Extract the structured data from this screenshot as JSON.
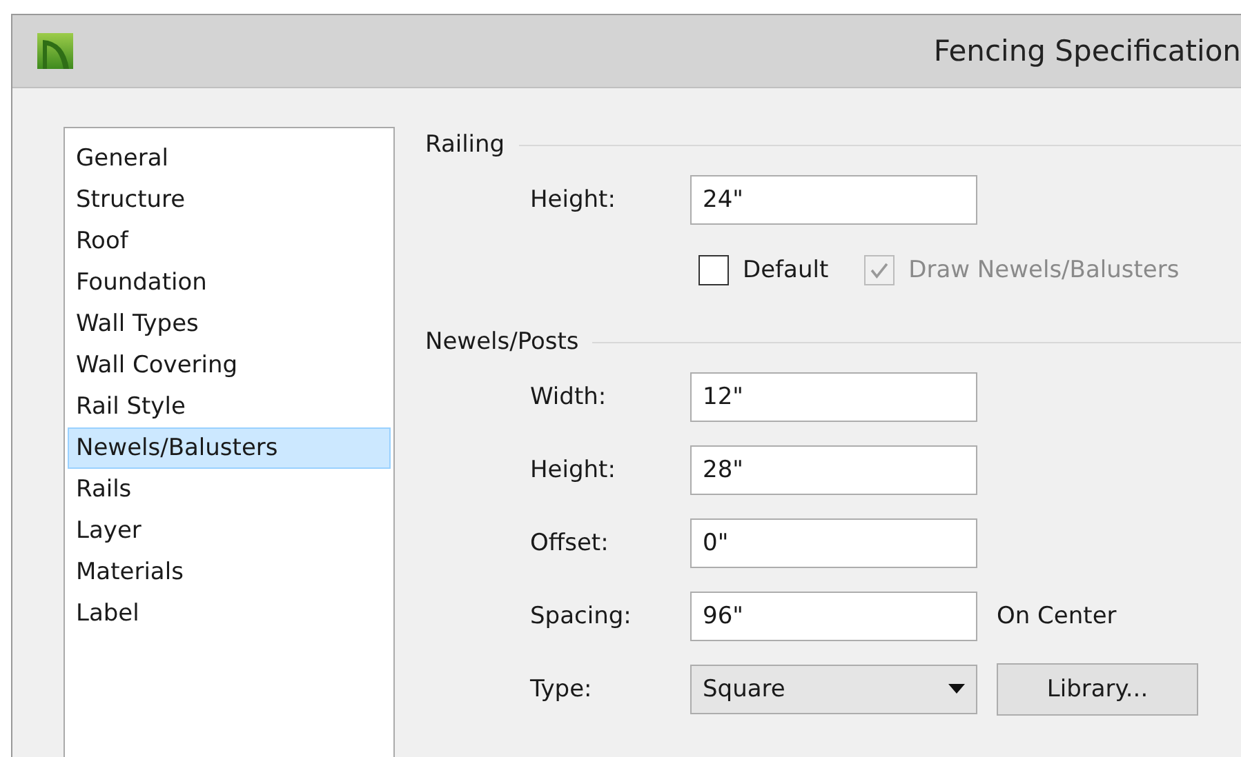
{
  "window": {
    "title": "Fencing Specification"
  },
  "sidebar": {
    "items": [
      {
        "label": "General",
        "selected": false
      },
      {
        "label": "Structure",
        "selected": false
      },
      {
        "label": "Roof",
        "selected": false
      },
      {
        "label": "Foundation",
        "selected": false
      },
      {
        "label": "Wall Types",
        "selected": false
      },
      {
        "label": "Wall Covering",
        "selected": false
      },
      {
        "label": "Rail Style",
        "selected": false
      },
      {
        "label": "Newels/Balusters",
        "selected": true
      },
      {
        "label": "Rails",
        "selected": false
      },
      {
        "label": "Layer",
        "selected": false
      },
      {
        "label": "Materials",
        "selected": false
      },
      {
        "label": "Label",
        "selected": false
      }
    ]
  },
  "railing": {
    "title": "Railing",
    "fields": [
      {
        "label": "Height:",
        "value": "24\""
      }
    ],
    "checkboxes": [
      {
        "label": "Default",
        "checked": false,
        "disabled": false
      },
      {
        "label": "Draw Newels/Balusters",
        "checked": true,
        "disabled": true
      }
    ]
  },
  "newels_posts": {
    "title": "Newels/Posts",
    "fields": [
      {
        "label": "Width:",
        "value": "12\"",
        "kind": "text"
      },
      {
        "label": "Height:",
        "value": "28\"",
        "kind": "text"
      },
      {
        "label": "Offset:",
        "value": "0\"",
        "kind": "text"
      },
      {
        "label": "Spacing:",
        "value": "96\"",
        "kind": "text",
        "suffix": "On Center"
      },
      {
        "label": "Type:",
        "value": "Square",
        "kind": "dropdown",
        "button": "Library..."
      }
    ]
  }
}
